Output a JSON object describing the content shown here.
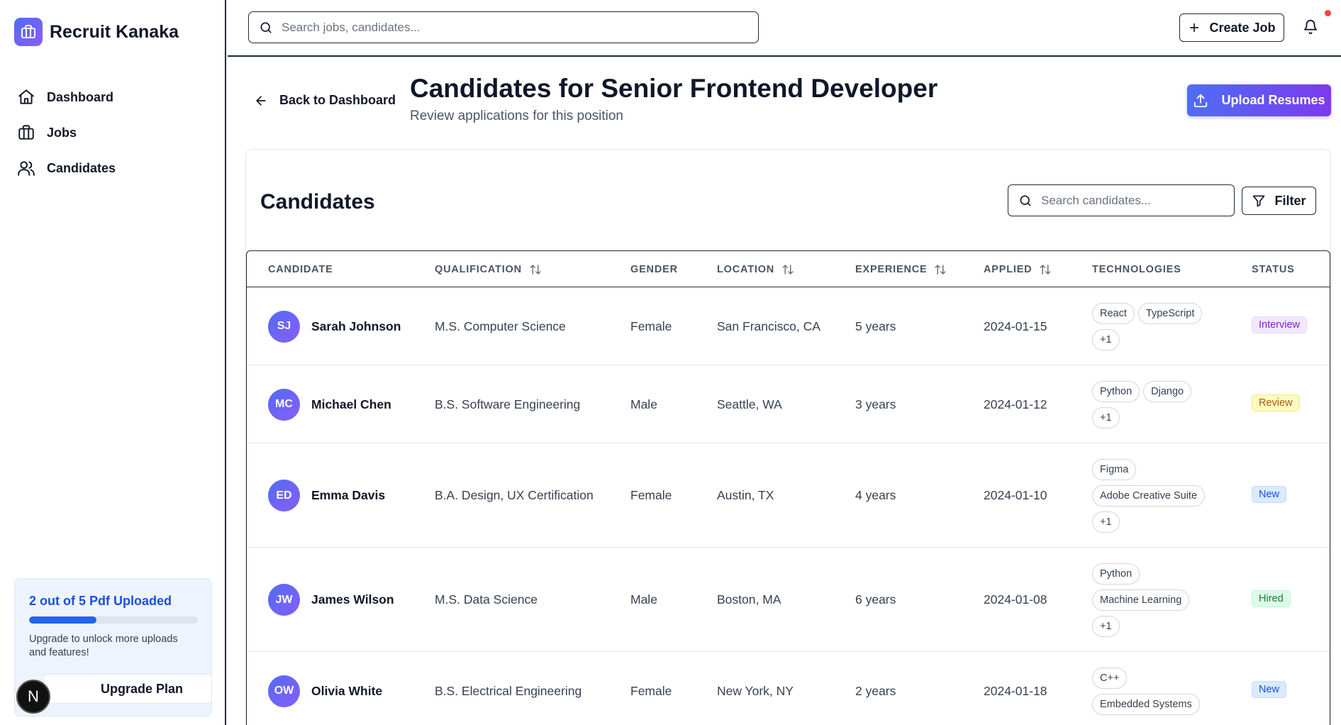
{
  "brand": {
    "name": "Recruit Kanaka"
  },
  "nav": [
    {
      "label": "Dashboard",
      "icon": "home-icon"
    },
    {
      "label": "Jobs",
      "icon": "briefcase-icon"
    },
    {
      "label": "Candidates",
      "icon": "users-icon"
    }
  ],
  "upgrade": {
    "title": "2 out of 5 Pdf Uploaded",
    "progress_fraction": 0.4,
    "description": "Upgrade to unlock more uploads and features!",
    "button": "Upgrade Plan"
  },
  "user_badge": "N",
  "topbar": {
    "search_placeholder": "Search jobs, candidates...",
    "create_job": "Create Job"
  },
  "header": {
    "back": "Back to Dashboard",
    "title": "Candidates for Senior Frontend Developer",
    "subtitle": "Review applications for this position",
    "upload": "Upload Resumes"
  },
  "card": {
    "title": "Candidates",
    "search_placeholder": "Search candidates...",
    "filter": "Filter"
  },
  "table": {
    "columns": [
      "CANDIDATE",
      "QUALIFICATION",
      "GENDER",
      "LOCATION",
      "EXPERIENCE",
      "APPLIED",
      "TECHNOLOGIES",
      "STATUS"
    ],
    "rows": [
      {
        "initials": "SJ",
        "name": "Sarah Johnson",
        "qualification": "M.S. Computer Science",
        "gender": "Female",
        "location": "San Francisco, CA",
        "experience": "5 years",
        "applied": "2024-01-15",
        "techs": [
          "React",
          "TypeScript",
          "+1"
        ],
        "status": "Interview",
        "status_class": "st-interview"
      },
      {
        "initials": "MC",
        "name": "Michael Chen",
        "qualification": "B.S. Software Engineering",
        "gender": "Male",
        "location": "Seattle, WA",
        "experience": "3 years",
        "applied": "2024-01-12",
        "techs": [
          "Python",
          "Django",
          "+1"
        ],
        "status": "Review",
        "status_class": "st-review"
      },
      {
        "initials": "ED",
        "name": "Emma Davis",
        "qualification": "B.A. Design, UX Certification",
        "gender": "Female",
        "location": "Austin, TX",
        "experience": "4 years",
        "applied": "2024-01-10",
        "techs": [
          "Figma",
          "Adobe Creative Suite",
          "+1"
        ],
        "status": "New",
        "status_class": "st-new"
      },
      {
        "initials": "JW",
        "name": "James Wilson",
        "qualification": "M.S. Data Science",
        "gender": "Male",
        "location": "Boston, MA",
        "experience": "6 years",
        "applied": "2024-01-08",
        "techs": [
          "Python",
          "Machine Learning",
          "+1"
        ],
        "status": "Hired",
        "status_class": "st-hired"
      },
      {
        "initials": "OW",
        "name": "Olivia White",
        "qualification": "B.S. Electrical Engineering",
        "gender": "Female",
        "location": "New York, NY",
        "experience": "2 years",
        "applied": "2024-01-18",
        "techs": [
          "C++",
          "Embedded Systems"
        ],
        "status": "New",
        "status_class": "st-new"
      }
    ]
  }
}
